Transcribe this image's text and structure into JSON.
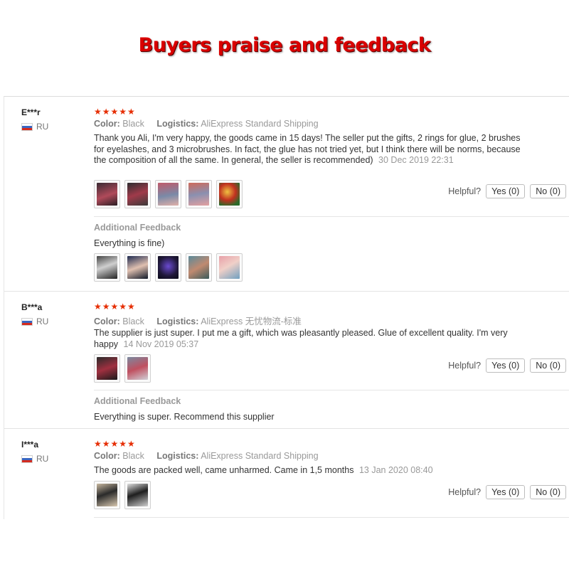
{
  "banner": {
    "title": "Buyers praise and feedback"
  },
  "helpful_label": "Helpful?",
  "meta_labels": {
    "color": "Color:",
    "logistics": "Logistics:"
  },
  "reviews": [
    {
      "user": "E***r",
      "country": "RU",
      "stars": "★★★★★",
      "color": "Black",
      "logistics": "AliExpress Standard Shipping",
      "text": "Thank you Ali, I'm very happy, the goods came in 15 days! The seller put the gifts, 2 rings for glue, 2 brushes for eyelashes, and 3 microbrushes. In fact, the glue has not tried yet, but I think there will be norms, because the composition of all the same. In general, the seller is recommended)",
      "date": "30 Dec 2019 22:31",
      "yes": "Yes (0)",
      "no": "No (0)",
      "additional_label": "Additional Feedback",
      "additional_text": "Everything is fine)"
    },
    {
      "user": "B***a",
      "country": "RU",
      "stars": "★★★★★",
      "color": "Black",
      "logistics": "AliExpress 无忧物流-标准",
      "text": "The supplier is just super. I put me a gift, which was pleasantly pleased. Glue of excellent quality. I'm very happy",
      "date": "14 Nov 2019 05:37",
      "yes": "Yes (0)",
      "no": "No (0)",
      "additional_label": "Additional Feedback",
      "additional_text": "Everything is super. Recommend this supplier"
    },
    {
      "user": "I***a",
      "country": "RU",
      "stars": "★★★★★",
      "color": "Black",
      "logistics": "AliExpress Standard Shipping",
      "text": "The goods are packed well, came unharmed. Came in 1,5 months",
      "date": "13 Jan 2020 08:40",
      "yes": "Yes (0)",
      "no": "No (0)"
    }
  ],
  "colors": {
    "banner": "#d90000",
    "stars": "#e62e04",
    "muted": "#999999"
  }
}
